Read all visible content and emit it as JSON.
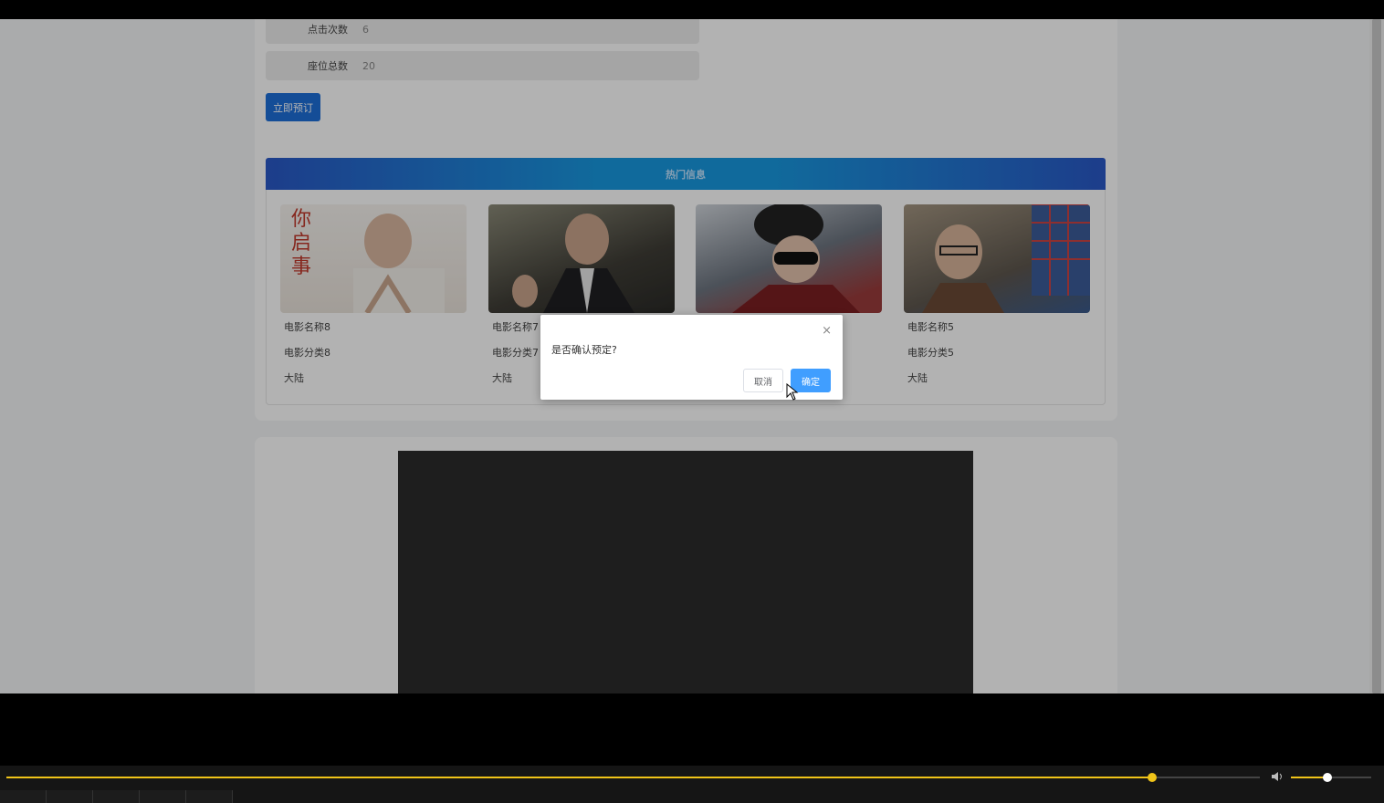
{
  "details": {
    "clicks_label": "点击次数",
    "clicks_value": "6",
    "seats_label": "座位总数",
    "seats_value": "20",
    "book_button": "立即预订"
  },
  "hot": {
    "title": "热门信息",
    "movies": [
      {
        "name": "电影名称8",
        "category": "电影分类8",
        "region": "大陆"
      },
      {
        "name": "电影名称7",
        "category": "电影分类7",
        "region": "大陆"
      },
      {
        "name": "",
        "category": "",
        "region": ""
      },
      {
        "name": "电影名称5",
        "category": "电影分类5",
        "region": "大陆"
      }
    ],
    "poster1_text": [
      "你",
      "启",
      "事"
    ]
  },
  "dialog": {
    "message": "是否确认预定?",
    "close": "×",
    "cancel": "取消",
    "ok": "确定"
  },
  "player": {
    "progress": 0.914,
    "volume": 0.45,
    "speaker_icon": "speaker-icon"
  }
}
